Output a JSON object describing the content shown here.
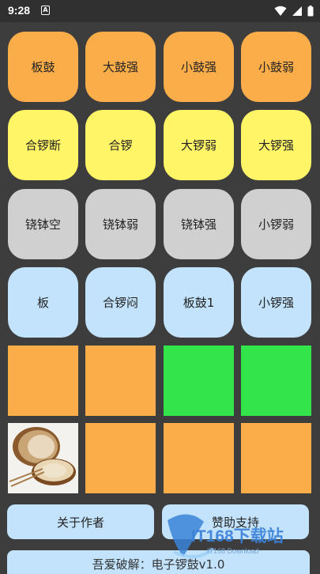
{
  "status_bar": {
    "time": "9:28",
    "notification_glyph": "A"
  },
  "buttons": [
    {
      "label": "板鼓",
      "color": "#fbad4a"
    },
    {
      "label": "大鼓强",
      "color": "#fbad4a"
    },
    {
      "label": "小鼓强",
      "color": "#fbad4a"
    },
    {
      "label": "小鼓弱",
      "color": "#fbad4a"
    },
    {
      "label": "合锣断",
      "color": "#fff567"
    },
    {
      "label": "合锣",
      "color": "#fff567"
    },
    {
      "label": "大锣弱",
      "color": "#fff567"
    },
    {
      "label": "大锣强",
      "color": "#fff567"
    },
    {
      "label": "铙钵空",
      "color": "#d0d0d0"
    },
    {
      "label": "铙钵弱",
      "color": "#d0d0d0"
    },
    {
      "label": "铙钵强",
      "color": "#d0d0d0"
    },
    {
      "label": "小锣弱",
      "color": "#d0d0d0"
    },
    {
      "label": "板",
      "color": "#c2e3fb"
    },
    {
      "label": "合锣闷",
      "color": "#c2e3fb"
    },
    {
      "label": "板鼓1",
      "color": "#c2e3fb"
    },
    {
      "label": "小锣强",
      "color": "#c2e3fb"
    }
  ],
  "pads_colors": {
    "orange": "#fbad4a",
    "green": "#33e54b"
  },
  "bottom": {
    "about_label": "关于作者",
    "support_label": "赞助支持"
  },
  "footer": {
    "text": "吾爱破解：电子锣鼓v1.0"
  },
  "watermark": {
    "brand": "IT168下载站",
    "sub": "IT168 Download"
  }
}
